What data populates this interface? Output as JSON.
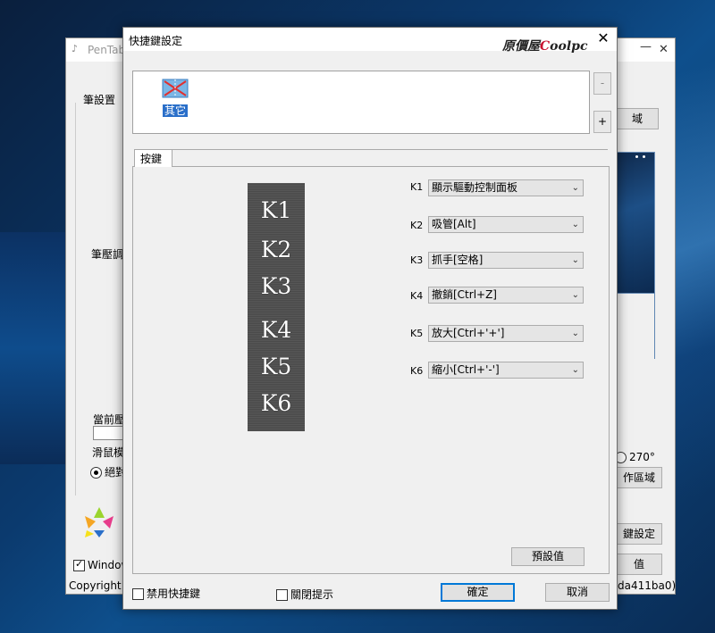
{
  "background_window": {
    "title": "PenTab",
    "minimize": "—",
    "close": "✕",
    "pen_settings": "筆設置",
    "pressure_adjust": "筆壓調",
    "current_pressure": "當前壓",
    "mouse_mode": "滑鼠模",
    "absolute": "絕對",
    "area_btn_top": "域",
    "rotate_270": "270°",
    "work_area_btn": "作區域",
    "key_settings_btn": "鍵設定",
    "value_btn": "值",
    "windows_ink": "Window",
    "copyright": "Copyright©",
    "version_tail": "da411ba0)"
  },
  "dialog": {
    "title": "快捷鍵設定",
    "brand_prefix": "原價屋",
    "brand_c": "C",
    "brand_suffix": "oolpc",
    "close": "✕",
    "app_name": "其它",
    "remove_btn": "-",
    "add_btn": "+",
    "tab_label": "按鍵",
    "pad_keys": [
      "K1",
      "K2",
      "K3",
      "K4",
      "K5",
      "K6"
    ],
    "key_rows": [
      {
        "label": "K1",
        "value": "顯示驅動控制面板"
      },
      {
        "label": "K2",
        "value": "吸管[Alt]"
      },
      {
        "label": "K3",
        "value": "抓手[空格]"
      },
      {
        "label": "K4",
        "value": "撤銷[Ctrl+Z]"
      },
      {
        "label": "K5",
        "value": "放大[Ctrl+'+']"
      },
      {
        "label": "K6",
        "value": "縮小[Ctrl+'-']"
      }
    ],
    "default_btn": "預設值",
    "disable_shortcuts": "禁用快捷鍵",
    "close_tips": "關閉提示",
    "ok_btn": "確定",
    "cancel_btn": "取消"
  },
  "colors": {
    "accent": "#0078d7",
    "selection": "#2a6fc9",
    "brand_red": "#c8102e"
  }
}
